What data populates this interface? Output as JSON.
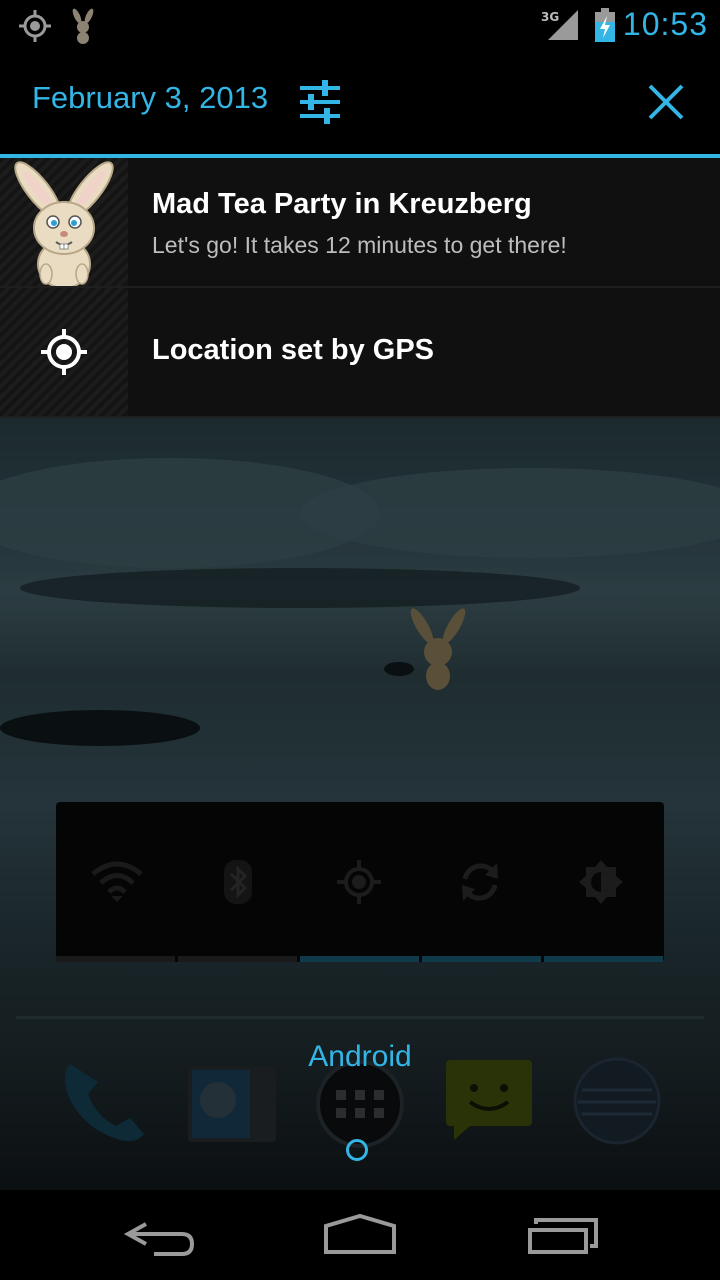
{
  "status_bar": {
    "network_type": "3G",
    "time": "10:53",
    "left_icons": [
      "location-target-icon",
      "bunny-icon"
    ]
  },
  "header": {
    "date": "February 3, 2013"
  },
  "notifications": [
    {
      "title": "Mad Tea Party in Kreuzberg",
      "text": "Let's go! It takes 12 minutes to get there!",
      "icon": "bunny-icon"
    },
    {
      "title": "Location set by GPS",
      "icon": "gps-target-icon"
    }
  ],
  "power_widget": {
    "toggles": [
      "wifi-icon",
      "bluetooth-icon",
      "gps-icon",
      "sync-icon",
      "brightness-icon"
    ]
  },
  "dock": {
    "folder_label": "Android",
    "apps": [
      "phone-icon",
      "contacts-icon",
      "app-drawer-icon",
      "messaging-icon",
      "browser-icon"
    ]
  },
  "colors": {
    "accent": "#33b5e5",
    "notification_bg": "#101010"
  }
}
